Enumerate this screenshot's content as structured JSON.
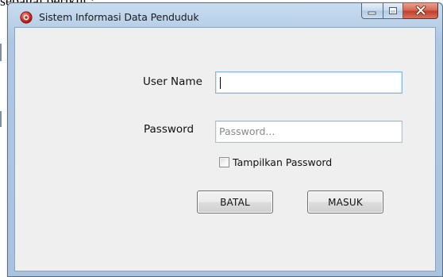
{
  "document": {
    "caption_fragment": "sebagai berikut :"
  },
  "window": {
    "title": "Sistem Informasi Data Penduduk",
    "icon": "app-icon",
    "caption_buttons": {
      "minimize_icon": "minimize-icon",
      "maximize_icon": "maximize-icon",
      "close_icon": "close-icon"
    }
  },
  "form": {
    "username": {
      "label": "User Name",
      "value": "",
      "focused": true
    },
    "password": {
      "label": "Password",
      "value": "",
      "placeholder": "Password..."
    },
    "show_password": {
      "label": "Tampilkan Password",
      "checked": false
    },
    "buttons": {
      "cancel": "BATAL",
      "login": "MASUK"
    }
  },
  "colors": {
    "window_frame": "#b8cfe7",
    "client_background": "#efefef",
    "close_button": "#c0402a"
  }
}
